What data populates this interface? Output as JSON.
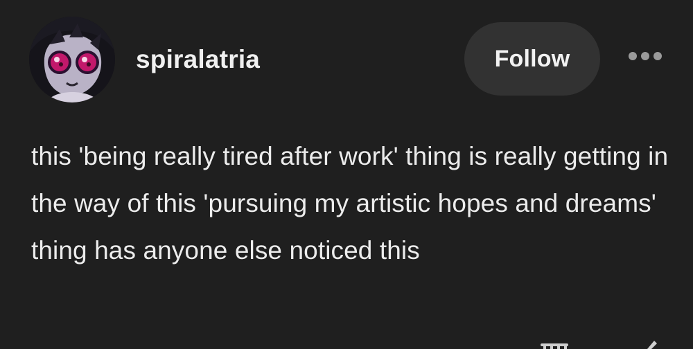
{
  "post": {
    "author": {
      "username": "spiralatria"
    },
    "follow_label": "Follow",
    "more_icon": "ellipsis-horizontal",
    "body": "this 'being really tired after work' thing is really getting in the way of this 'pursuing my artistic hopes and dreams' thing has anyone else noticed this"
  },
  "colors": {
    "background": "#1f1f1f",
    "text": "#ececec",
    "button_bg": "#323232",
    "avatar_eye": "#c2186b"
  }
}
